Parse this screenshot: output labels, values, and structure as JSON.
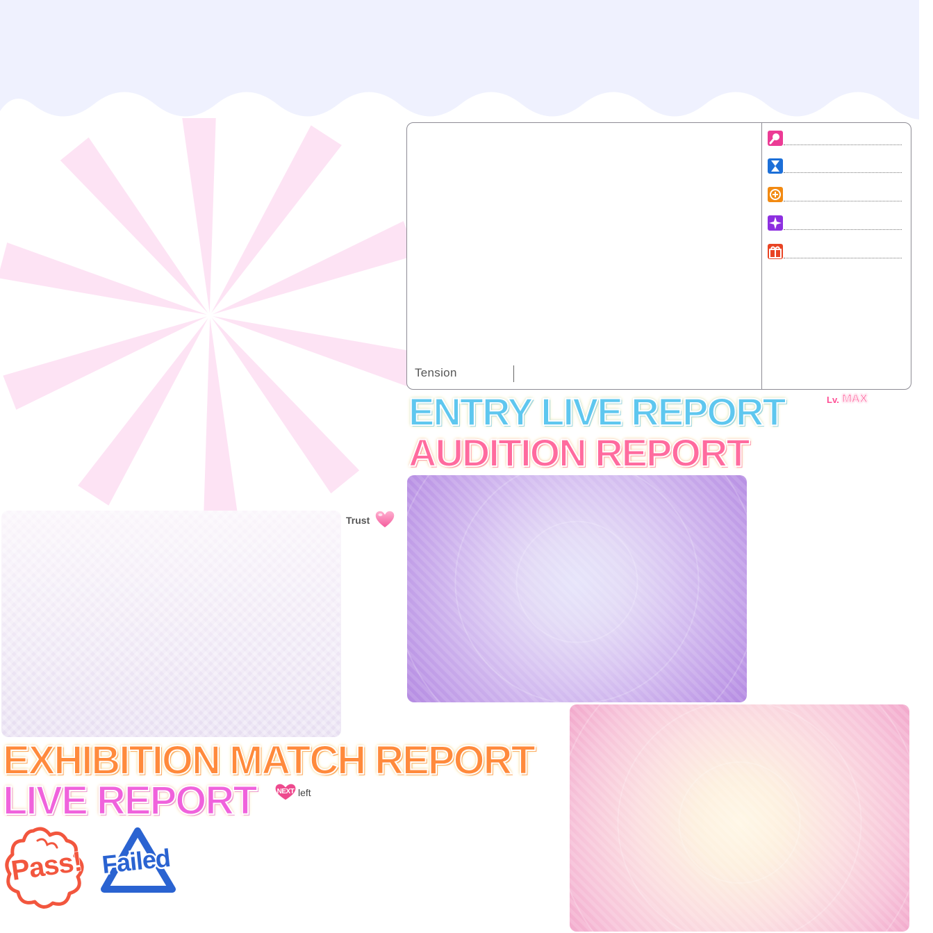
{
  "stats_panel": {
    "tension_label": "Tension",
    "stat_icons": [
      "mic-icon",
      "hourglass-icon",
      "orange-badge-icon",
      "purple-sparkle-icon",
      "gift-icon"
    ]
  },
  "titles": {
    "entry": "ENTRY LIVE REPORT",
    "audition": "AUDITION REPORT",
    "exhibition": "EXHIBITION MATCH REPORT",
    "live": "LIVE REPORT"
  },
  "level_badge": {
    "prefix": "Lv.",
    "value": "MAX"
  },
  "trust": {
    "label": "Trust",
    "icon": "heart-icon"
  },
  "next_badge": {
    "text": "NEXT",
    "suffix": "left"
  },
  "results": {
    "pass": "Pass!",
    "failed": "Failed"
  },
  "colors": {
    "banner": "#eff1fe",
    "burst": "#fde3f4",
    "entry": "#5ec7ef",
    "audition": "#ff6b9e",
    "exhibition": "#ff8a3c",
    "live": "#f062dc",
    "pass": "#f2563e",
    "failed": "#2a63d1"
  }
}
